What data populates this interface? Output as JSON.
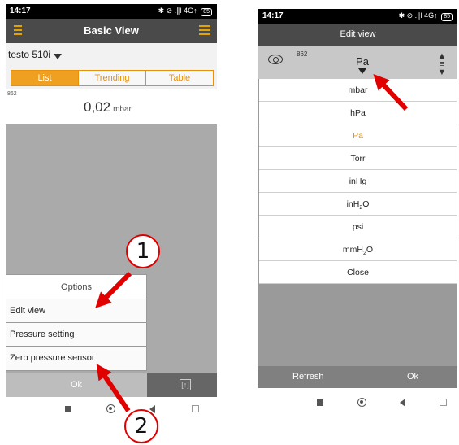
{
  "left_phone": {
    "status": {
      "time": "14:17",
      "icons": "✱ ⊘ .∥l 4G↑",
      "battery": "85"
    },
    "header": {
      "title": "Basic View"
    },
    "device_selector": {
      "label": "testo 510i"
    },
    "tabs": [
      "List",
      "Trending",
      "Table"
    ],
    "reading": {
      "index": "862",
      "value": "0,02",
      "unit": "mbar"
    },
    "options_menu": {
      "title": "Options",
      "items": [
        "Edit view",
        "Pressure setting",
        "Zero pressure sensor"
      ]
    },
    "bottom_bar": {
      "ok_label": "Ok",
      "export_icon": "[↑]"
    }
  },
  "right_phone": {
    "status": {
      "time": "14:17",
      "icons": "✱ ⊘ .∥l 4G↑",
      "battery": "85"
    },
    "header": {
      "title": "Edit view"
    },
    "toolrow": {
      "index": "862",
      "unit_current": "Pa"
    },
    "units": [
      "mbar",
      "hPa",
      "Pa",
      "Torr",
      "inHg",
      "inH",
      "psi",
      "mmH"
    ],
    "unit_subs": [
      "",
      "",
      "",
      "",
      "",
      "2",
      "",
      "2"
    ],
    "unit_tails": [
      "",
      "",
      "",
      "",
      "",
      "O",
      "",
      "O"
    ],
    "close_label": "Close",
    "bottom_bar": {
      "refresh_label": "Refresh",
      "ok_label": "Ok"
    }
  },
  "callouts": {
    "one": "1",
    "two": "2"
  },
  "colors": {
    "accent": "#e8900a",
    "arrow": "#e00000",
    "header": "#4a4a4a"
  }
}
